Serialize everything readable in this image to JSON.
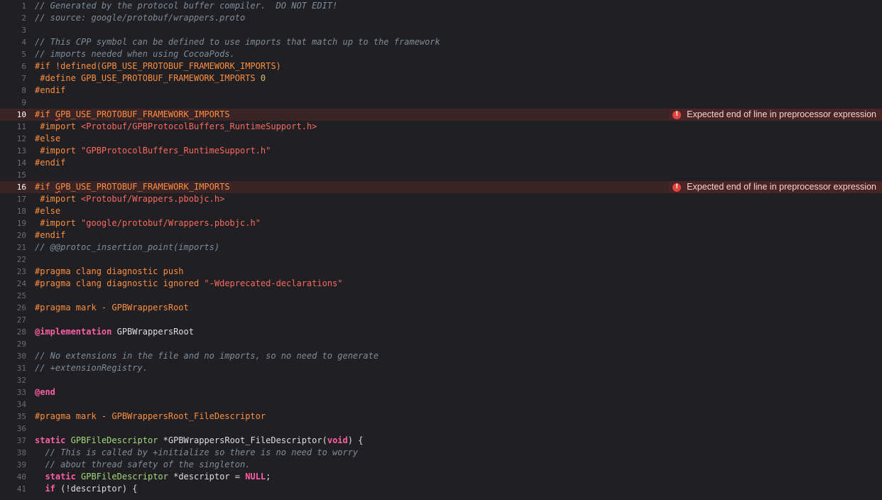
{
  "errors": {
    "icon": "error-circle-icon",
    "message": "Expected end of line in preprocessor expression",
    "color": "#e0443e"
  },
  "lines": [
    {
      "n": "1",
      "tokens": [
        {
          "t": "cm",
          "v": "// Generated by the protocol buffer compiler.  DO NOT EDIT!"
        }
      ]
    },
    {
      "n": "2",
      "tokens": [
        {
          "t": "cm",
          "v": "// source: google/protobuf/wrappers.proto"
        }
      ]
    },
    {
      "n": "3",
      "tokens": []
    },
    {
      "n": "4",
      "tokens": [
        {
          "t": "cm",
          "v": "// This CPP symbol can be defined to use imports that match up to the framework"
        }
      ]
    },
    {
      "n": "5",
      "tokens": [
        {
          "t": "cm",
          "v": "// imports needed when using CocoaPods."
        }
      ]
    },
    {
      "n": "6",
      "tokens": [
        {
          "t": "pp",
          "v": "#if !defined(GPB_USE_PROTOBUF_FRAMEWORK_IMPORTS)"
        }
      ]
    },
    {
      "n": "7",
      "tokens": [
        {
          "t": "pp",
          "v": " #define GPB_USE_PROTOBUF_FRAMEWORK_IMPORTS "
        },
        {
          "t": "num",
          "v": "0"
        }
      ]
    },
    {
      "n": "8",
      "tokens": [
        {
          "t": "pp",
          "v": "#endif"
        }
      ]
    },
    {
      "n": "9",
      "tokens": []
    },
    {
      "n": "10",
      "error": true,
      "tokens": [
        {
          "t": "pp",
          "v": "#if "
        },
        {
          "t": "pp errm",
          "v": "G"
        },
        {
          "t": "pp",
          "v": "PB_USE_PROTOBUF_FRAMEWORK_IMPORTS"
        }
      ]
    },
    {
      "n": "11",
      "tokens": [
        {
          "t": "pp",
          "v": " #import "
        },
        {
          "t": "str",
          "v": "<Protobuf/GPBProtocolBuffers_RuntimeSupport.h>"
        }
      ]
    },
    {
      "n": "12",
      "tokens": [
        {
          "t": "pp",
          "v": "#else"
        }
      ]
    },
    {
      "n": "13",
      "tokens": [
        {
          "t": "pp",
          "v": " #import "
        },
        {
          "t": "str",
          "v": "\"GPBProtocolBuffers_RuntimeSupport.h\""
        }
      ]
    },
    {
      "n": "14",
      "tokens": [
        {
          "t": "pp",
          "v": "#endif"
        }
      ]
    },
    {
      "n": "15",
      "tokens": []
    },
    {
      "n": "16",
      "error": true,
      "tokens": [
        {
          "t": "pp",
          "v": "#if "
        },
        {
          "t": "pp errm",
          "v": "G"
        },
        {
          "t": "pp",
          "v": "PB_USE_PROTOBUF_FRAMEWORK_IMPORTS"
        }
      ]
    },
    {
      "n": "17",
      "tokens": [
        {
          "t": "pp",
          "v": " #import "
        },
        {
          "t": "str",
          "v": "<Protobuf/Wrappers.pbobjc.h>"
        }
      ]
    },
    {
      "n": "18",
      "tokens": [
        {
          "t": "pp",
          "v": "#else"
        }
      ]
    },
    {
      "n": "19",
      "tokens": [
        {
          "t": "pp",
          "v": " #import "
        },
        {
          "t": "str",
          "v": "\"google/protobuf/Wrappers.pbobjc.h\""
        }
      ]
    },
    {
      "n": "20",
      "tokens": [
        {
          "t": "pp",
          "v": "#endif"
        }
      ]
    },
    {
      "n": "21",
      "tokens": [
        {
          "t": "cm",
          "v": "// @@protoc_insertion_point(imports)"
        }
      ]
    },
    {
      "n": "22",
      "tokens": []
    },
    {
      "n": "23",
      "tokens": [
        {
          "t": "pp",
          "v": "#pragma clang diagnostic push"
        }
      ]
    },
    {
      "n": "24",
      "tokens": [
        {
          "t": "pp",
          "v": "#pragma clang diagnostic ignored "
        },
        {
          "t": "str",
          "v": "\"-Wdeprecated-declarations\""
        }
      ]
    },
    {
      "n": "25",
      "tokens": []
    },
    {
      "n": "26",
      "tokens": [
        {
          "t": "pp",
          "v": "#pragma mark - GPBWrappersRoot"
        }
      ]
    },
    {
      "n": "27",
      "tokens": []
    },
    {
      "n": "28",
      "tokens": [
        {
          "t": "kw",
          "v": "@implementation"
        },
        {
          "t": "pl",
          "v": " GPBWrappersRoot"
        }
      ]
    },
    {
      "n": "29",
      "tokens": []
    },
    {
      "n": "30",
      "tokens": [
        {
          "t": "cm",
          "v": "// No extensions in the file and no imports, so no need to generate"
        }
      ]
    },
    {
      "n": "31",
      "tokens": [
        {
          "t": "cm",
          "v": "// +extensionRegistry."
        }
      ]
    },
    {
      "n": "32",
      "tokens": []
    },
    {
      "n": "33",
      "tokens": [
        {
          "t": "kw",
          "v": "@end"
        }
      ]
    },
    {
      "n": "34",
      "tokens": []
    },
    {
      "n": "35",
      "tokens": [
        {
          "t": "pp",
          "v": "#pragma mark - GPBWrappersRoot_FileDescriptor"
        }
      ]
    },
    {
      "n": "36",
      "tokens": []
    },
    {
      "n": "37",
      "tokens": [
        {
          "t": "kw",
          "v": "static"
        },
        {
          "t": "pl",
          "v": " "
        },
        {
          "t": "ty2",
          "v": "GPBFileDescriptor"
        },
        {
          "t": "pl",
          "v": " *GPBWrappersRoot_FileDescriptor("
        },
        {
          "t": "kw",
          "v": "void"
        },
        {
          "t": "pl",
          "v": ") {"
        }
      ]
    },
    {
      "n": "38",
      "tokens": [
        {
          "t": "cm",
          "v": "  // This is called by +initialize so there is no need to worry"
        }
      ]
    },
    {
      "n": "39",
      "tokens": [
        {
          "t": "cm",
          "v": "  // about thread safety of the singleton."
        }
      ]
    },
    {
      "n": "40",
      "tokens": [
        {
          "t": "pl",
          "v": "  "
        },
        {
          "t": "kw",
          "v": "static"
        },
        {
          "t": "pl",
          "v": " "
        },
        {
          "t": "ty2",
          "v": "GPBFileDescriptor"
        },
        {
          "t": "pl",
          "v": " *descriptor = "
        },
        {
          "t": "kw",
          "v": "NULL"
        },
        {
          "t": "pl",
          "v": ";"
        }
      ]
    },
    {
      "n": "41",
      "tokens": [
        {
          "t": "pl",
          "v": "  "
        },
        {
          "t": "kw",
          "v": "if"
        },
        {
          "t": "pl",
          "v": " (!descriptor) {"
        }
      ]
    }
  ]
}
